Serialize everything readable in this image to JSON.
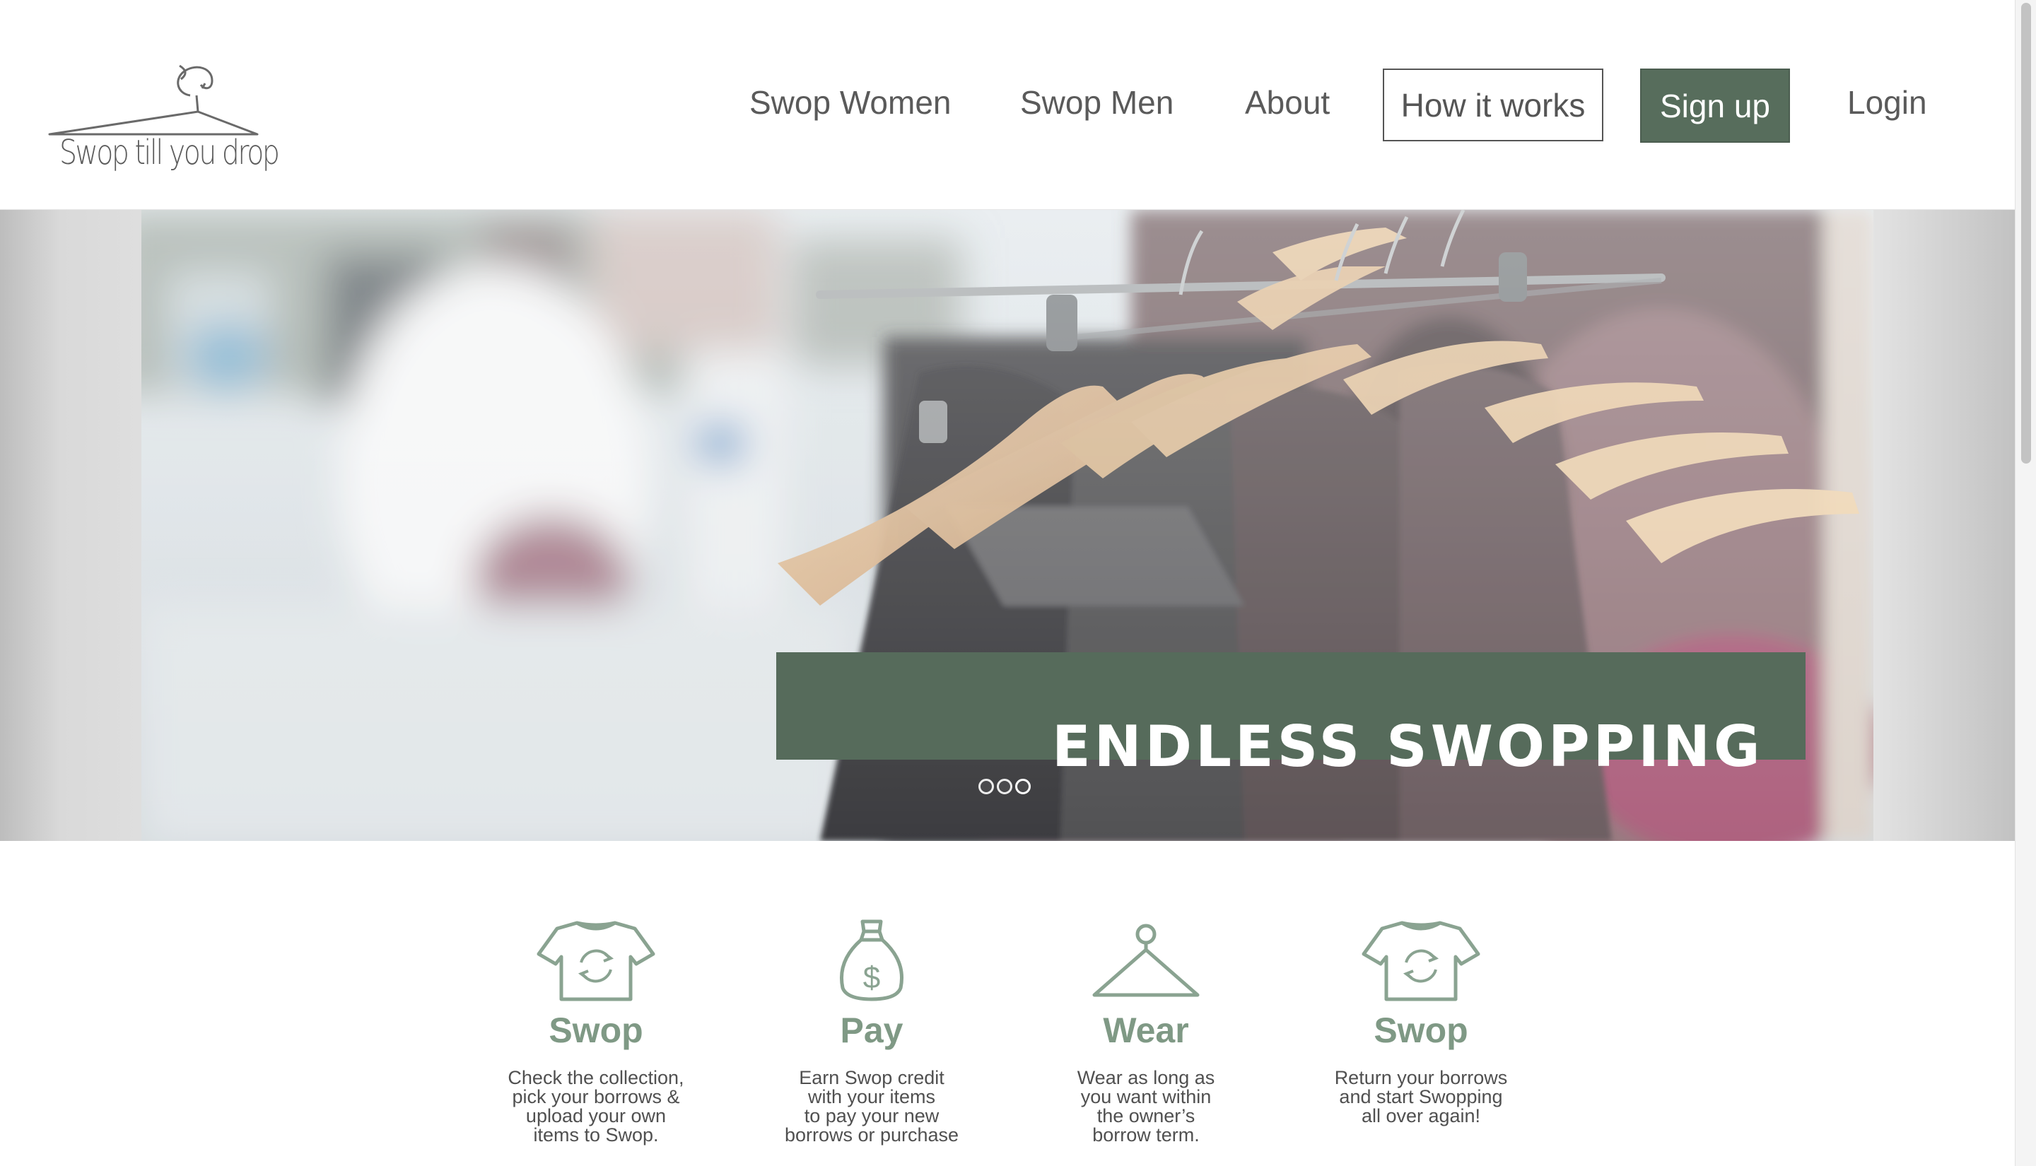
{
  "brand": {
    "logo_text": "Swop till you drop"
  },
  "nav": {
    "items": [
      "Swop Women",
      "Swop Men",
      "About"
    ],
    "how_it_works": "How it works",
    "sign_up": "Sign up",
    "login": "Login"
  },
  "hero": {
    "title": "ENDLESS SWOPPING",
    "slides": 3,
    "active_slide": 1
  },
  "steps": [
    {
      "icon": "tshirt-cycle-icon",
      "title": "Swop",
      "text": "Check the collection,\npick your borrows &\nupload your own\nitems to Swop."
    },
    {
      "icon": "money-bag-icon",
      "title": "Pay",
      "text": "Earn Swop credit\nwith your items\nto pay your new\nborrows or purchase"
    },
    {
      "icon": "hanger-icon",
      "title": "Wear",
      "text": "Wear as long as\nyou want within\nthe owner’s\nborrow term."
    },
    {
      "icon": "tshirt-cycle-icon",
      "title": "Swop",
      "text": "Return your borrows\nand start Swopping\nall over again!"
    }
  ],
  "colors": {
    "accent": "#576d5c",
    "step_title": "#7f9985",
    "icon_stroke": "#8aa391",
    "nav_text": "#5a5a5a"
  }
}
